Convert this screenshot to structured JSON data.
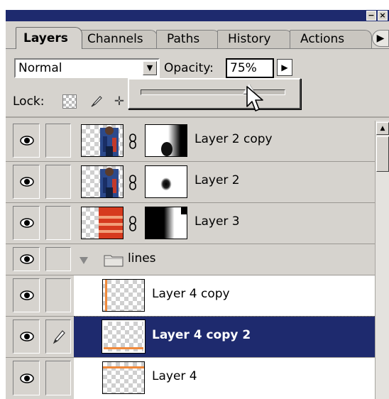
{
  "tabs": [
    {
      "label": "Layers",
      "active": true
    },
    {
      "label": "Channels",
      "active": false
    },
    {
      "label": "Paths",
      "active": false
    },
    {
      "label": "History",
      "active": false
    },
    {
      "label": "Actions",
      "active": false
    }
  ],
  "controls": {
    "blend_mode": "Normal",
    "opacity_label": "Opacity:",
    "opacity_value": "75%",
    "opacity_slider_fraction": 0.75,
    "lock_label": "Lock:"
  },
  "layers": [
    {
      "name": "Layer 2 copy",
      "visible": true,
      "linked": false,
      "has_mask": true,
      "thumb": "person"
    },
    {
      "name": "Layer 2",
      "visible": true,
      "linked": false,
      "has_mask": true,
      "thumb": "person"
    },
    {
      "name": "Layer 3",
      "visible": true,
      "linked": false,
      "has_mask": true,
      "thumb": "red-stripes"
    },
    {
      "name": "lines",
      "type": "group",
      "visible": true,
      "expanded": true
    },
    {
      "name": "Layer 4 copy",
      "visible": true,
      "linked": false,
      "in_group": true,
      "thumb": "orange-vertical-line"
    },
    {
      "name": "Layer 4 copy 2",
      "visible": true,
      "selected": true,
      "active_paint": true,
      "in_group": true,
      "thumb": "orange-bottom-line"
    },
    {
      "name": "Layer 4",
      "visible": true,
      "linked": false,
      "in_group": true,
      "thumb": "orange-top-line"
    }
  ],
  "colors": {
    "titlebar": "#1e2a6e",
    "selection": "#1e2a6e",
    "panel": "#d6d3ce",
    "accent_orange": "#f08a3c"
  },
  "icons": [
    "eye-icon",
    "paintbrush-icon",
    "chain-link-icon",
    "folder-icon",
    "expand-triangle-icon",
    "checkerboard-lock-icon",
    "move-lock-icon",
    "minimize-icon",
    "close-icon",
    "panel-menu-icon",
    "arrow-cursor-icon"
  ]
}
